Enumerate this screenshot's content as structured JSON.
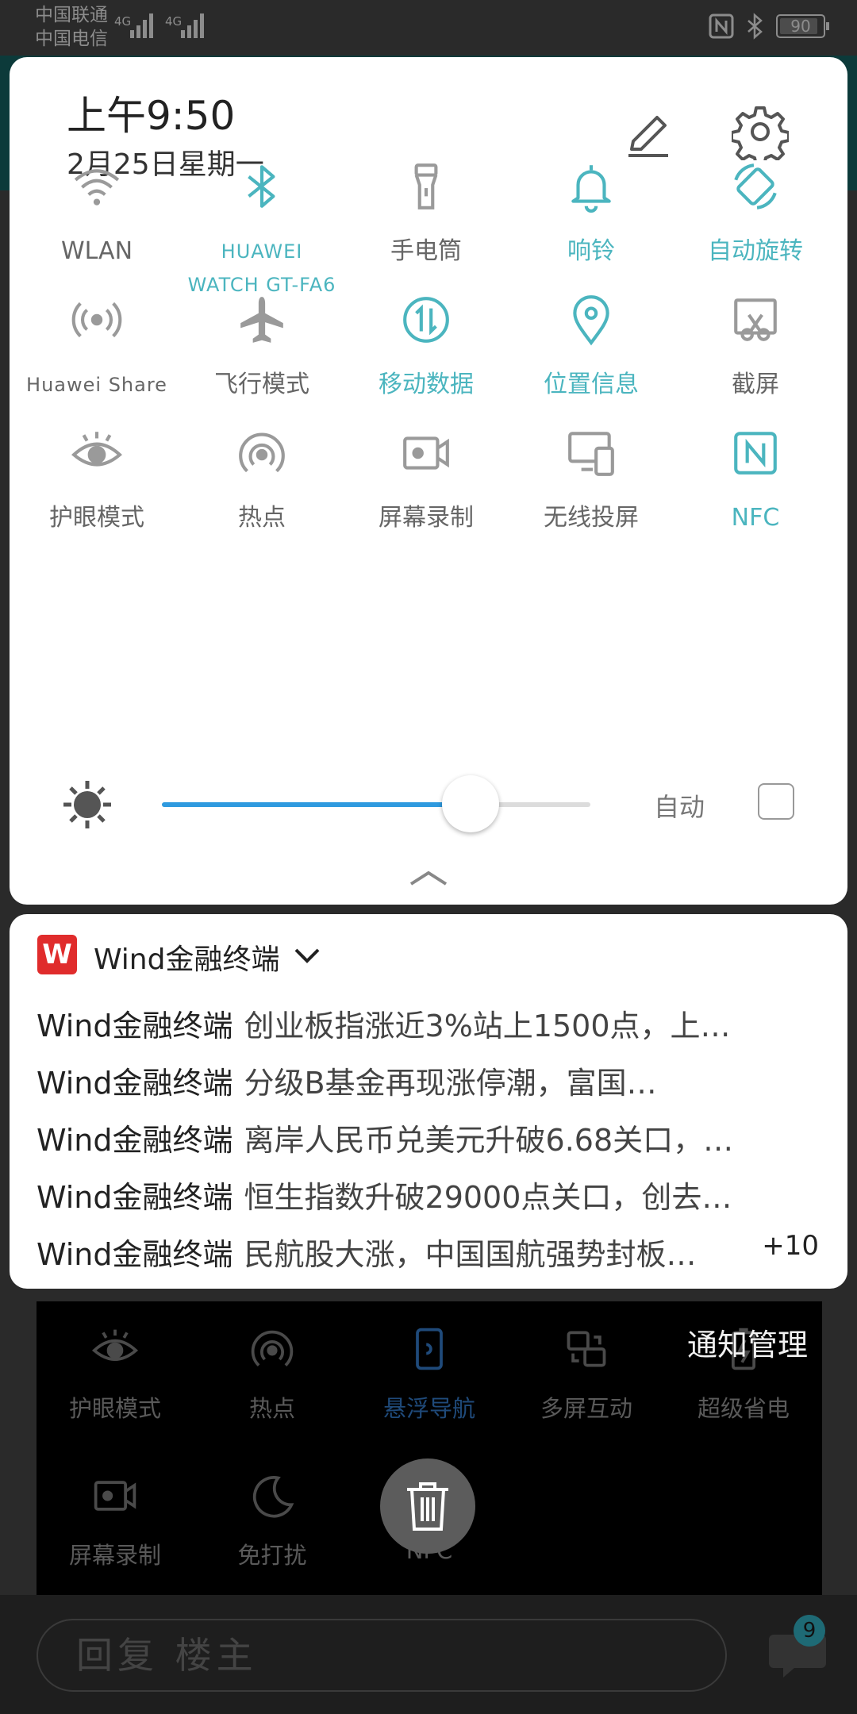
{
  "status_bar": {
    "carrier1": "中国联通",
    "carrier2": "中国电信",
    "net1": "4G",
    "net2": "4G",
    "battery": "90",
    "battery_level": 0.9
  },
  "quick_settings": {
    "time": "上午9:50",
    "date": "2月25日星期一",
    "tiles": [
      {
        "label": "WLAN",
        "icon": "wifi-icon",
        "active": false
      },
      {
        "label": "HUAWEI WATCH GT-FA6",
        "icon": "bluetooth-icon",
        "active": true
      },
      {
        "label": "手电筒",
        "icon": "flashlight-icon",
        "active": false
      },
      {
        "label": "响铃",
        "icon": "bell-icon",
        "active": true
      },
      {
        "label": "自动旋转",
        "icon": "auto-rotate-icon",
        "active": true
      },
      {
        "label": "Huawei Share",
        "icon": "huawei-share-icon",
        "active": false
      },
      {
        "label": "飞行模式",
        "icon": "airplane-icon",
        "active": false
      },
      {
        "label": "移动数据",
        "icon": "mobile-data-icon",
        "active": true
      },
      {
        "label": "位置信息",
        "icon": "location-icon",
        "active": true
      },
      {
        "label": "截屏",
        "icon": "screenshot-icon",
        "active": false
      },
      {
        "label": "护眼模式",
        "icon": "eye-icon",
        "active": false
      },
      {
        "label": "热点",
        "icon": "hotspot-icon",
        "active": false
      },
      {
        "label": "屏幕录制",
        "icon": "screen-record-icon",
        "active": false
      },
      {
        "label": "无线投屏",
        "icon": "wireless-projection-icon",
        "active": false
      },
      {
        "label": "NFC",
        "icon": "nfc-icon",
        "active": true
      }
    ],
    "brightness_level": 0.72,
    "auto_label": "自动",
    "auto_checked": false
  },
  "notification": {
    "app_name": "Wind金融终端",
    "app_icon_letter": "W",
    "items": [
      {
        "source": "Wind金融终端",
        "text": "创业板指涨近3%站上1500点，上…"
      },
      {
        "source": "Wind金融终端",
        "text": "分级B基金再现涨停潮，富国…"
      },
      {
        "source": "Wind金融终端",
        "text": "离岸人民币兑美元升破6.68关口，…"
      },
      {
        "source": "Wind金融终端",
        "text": "恒生指数升破29000点关口，创去…"
      },
      {
        "source": "Wind金融终端",
        "text": "民航股大涨，中国国航强势封板…"
      }
    ],
    "more_count": "+10"
  },
  "manage_label": "通知管理",
  "background": {
    "tiles": [
      {
        "label": "护眼模式",
        "icon": "eye-icon",
        "active": false
      },
      {
        "label": "热点",
        "icon": "hotspot-icon",
        "active": false
      },
      {
        "label": "悬浮导航",
        "icon": "floating-nav-icon",
        "active": true
      },
      {
        "label": "多屏互动",
        "icon": "multi-screen-icon",
        "active": false
      },
      {
        "label": "超级省电",
        "icon": "power-saving-icon",
        "active": false
      },
      {
        "label": "屏幕录制",
        "icon": "screen-record-icon",
        "active": false
      },
      {
        "label": "免打扰",
        "icon": "moon-icon",
        "active": false
      },
      {
        "label": "NFC",
        "icon": "nfc-icon",
        "active": false
      }
    ],
    "reply_placeholder": "回复  楼主",
    "badge": "9"
  },
  "colors": {
    "accent": "#4bb5bf",
    "slider": "#2f9adf",
    "inactive": "#9a9a9a"
  }
}
